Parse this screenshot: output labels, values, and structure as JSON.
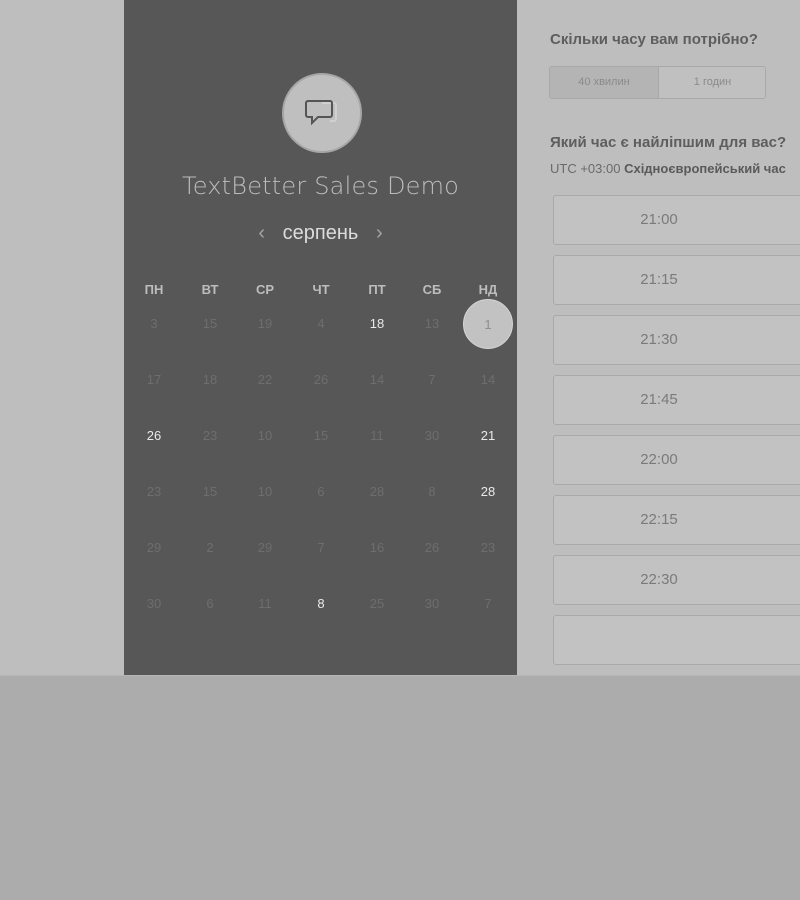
{
  "calendar": {
    "company_name": "TextBetter Sales Demo",
    "month": "серпень",
    "prev_icon": "chevron-left-icon",
    "next_icon": "chevron-right-icon",
    "logo_icon": "chat-bubble-icon",
    "weekdays": [
      "ПН",
      "ВТ",
      "СР",
      "ЧТ",
      "ПТ",
      "СБ",
      "НД"
    ],
    "rows": [
      [
        {
          "d": "3",
          "a": false
        },
        {
          "d": "15",
          "a": false
        },
        {
          "d": "19",
          "a": false
        },
        {
          "d": "4",
          "a": false
        },
        {
          "d": "18",
          "a": true
        },
        {
          "d": "13",
          "a": false
        },
        {
          "d": "1",
          "a": true,
          "selected": true
        }
      ],
      [
        {
          "d": "17",
          "a": false
        },
        {
          "d": "18",
          "a": false
        },
        {
          "d": "22",
          "a": false
        },
        {
          "d": "26",
          "a": false
        },
        {
          "d": "14",
          "a": false
        },
        {
          "d": "7",
          "a": false
        },
        {
          "d": "14",
          "a": false
        }
      ],
      [
        {
          "d": "26",
          "a": true
        },
        {
          "d": "23",
          "a": false
        },
        {
          "d": "10",
          "a": false
        },
        {
          "d": "15",
          "a": false
        },
        {
          "d": "11",
          "a": false
        },
        {
          "d": "30",
          "a": false
        },
        {
          "d": "21",
          "a": true
        }
      ],
      [
        {
          "d": "23",
          "a": false
        },
        {
          "d": "15",
          "a": false
        },
        {
          "d": "10",
          "a": false
        },
        {
          "d": "6",
          "a": false
        },
        {
          "d": "28",
          "a": false
        },
        {
          "d": "8",
          "a": false
        },
        {
          "d": "28",
          "a": true
        }
      ],
      [
        {
          "d": "29",
          "a": false
        },
        {
          "d": "2",
          "a": false
        },
        {
          "d": "29",
          "a": false
        },
        {
          "d": "7",
          "a": false
        },
        {
          "d": "16",
          "a": false
        },
        {
          "d": "26",
          "a": false
        },
        {
          "d": "23",
          "a": false
        }
      ],
      [
        {
          "d": "30",
          "a": false
        },
        {
          "d": "6",
          "a": false
        },
        {
          "d": "11",
          "a": false
        },
        {
          "d": "8",
          "a": true
        },
        {
          "d": "25",
          "a": false
        },
        {
          "d": "30",
          "a": false
        },
        {
          "d": "7",
          "a": false
        }
      ]
    ]
  },
  "booking": {
    "duration_question": "Скільки часу вам потрібно?",
    "durations": [
      "40 хвилин",
      "1 годин"
    ],
    "time_question": "Який час є найліпшим для вас?",
    "timezone_offset": "UTC +03:00",
    "timezone_name": "Східноєвропейський час",
    "slots": [
      "21:00",
      "21:15",
      "21:30",
      "21:45",
      "22:00",
      "22:15",
      "22:30",
      ""
    ]
  }
}
